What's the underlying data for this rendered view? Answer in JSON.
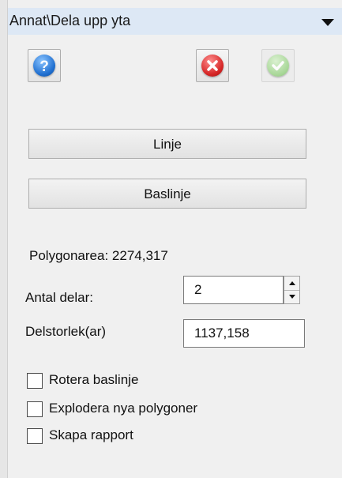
{
  "header": {
    "title": "Annat\\Dela upp yta"
  },
  "toolbar": {
    "help_icon": "help-icon",
    "cancel_icon": "cancel-icon",
    "ok_icon": "ok-icon"
  },
  "buttons": {
    "line_label": "Linje",
    "baseline_label": "Baslinje"
  },
  "info": {
    "polygon_area": "Polygonarea: 2274,317"
  },
  "fields": {
    "parts_label": "Antal delar:",
    "parts_value": "2",
    "part_size_label": "Delstorlek(ar)",
    "part_size_value": "1137,158"
  },
  "options": [
    {
      "label": "Rotera baslinje",
      "checked": false
    },
    {
      "label": "Explodera nya polygoner",
      "checked": false
    },
    {
      "label": "Skapa rapport",
      "checked": false
    }
  ],
  "colors": {
    "title_bar": "#dde8f5",
    "panel": "#f0f0f0",
    "help": "#1f6fd0",
    "cancel": "#d52525",
    "ok_disabled": "#9fd58c"
  }
}
